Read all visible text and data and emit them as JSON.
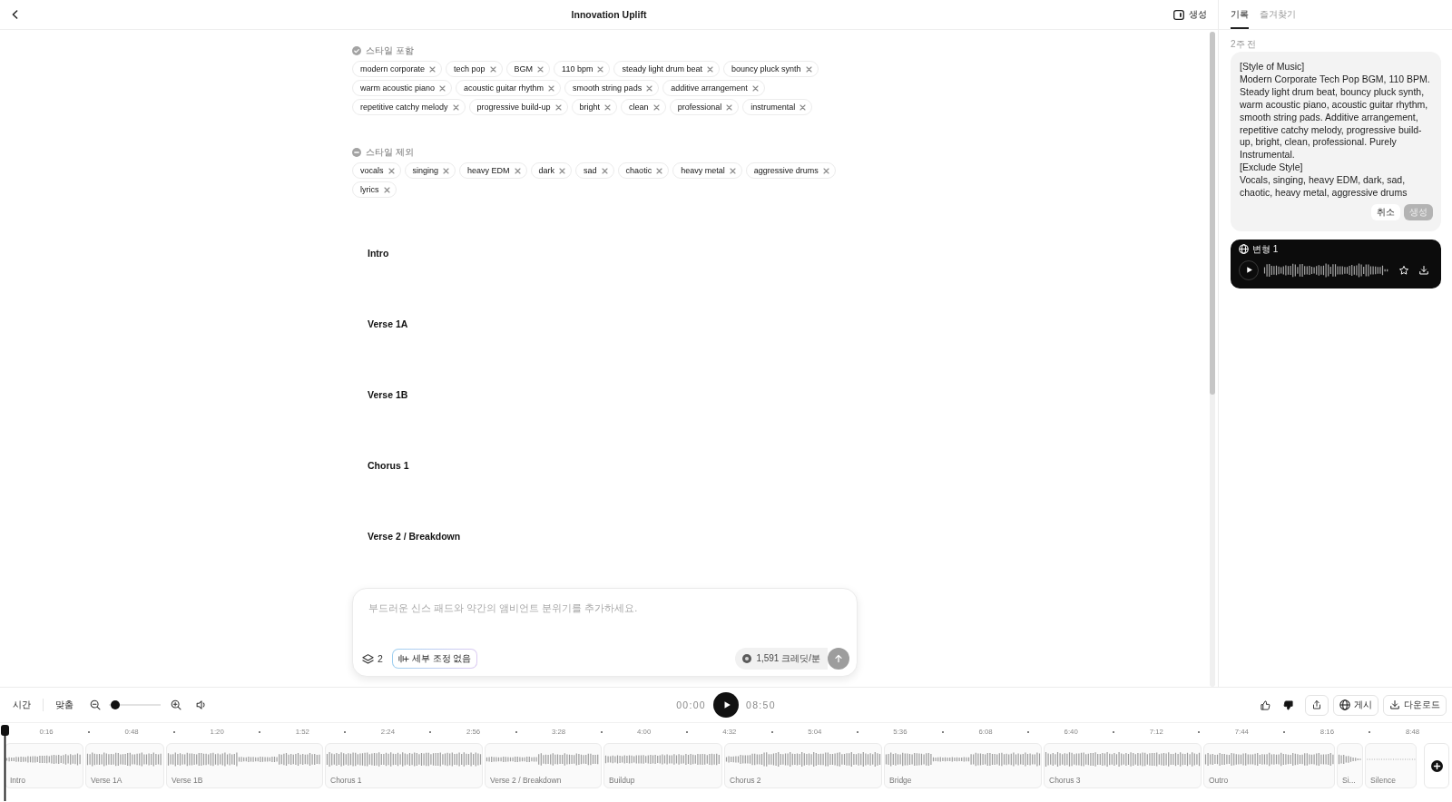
{
  "header": {
    "title": "Innovation Uplift",
    "panel_button": "생성"
  },
  "style_groups": [
    {
      "kind": "include",
      "heading": "스타일 포함",
      "tags": [
        "modern corporate",
        "tech pop",
        "BGM",
        "110 bpm",
        "steady light drum beat",
        "bouncy pluck synth",
        "warm acoustic piano",
        "acoustic guitar rhythm",
        "smooth string pads",
        "additive arrangement",
        "repetitive catchy melody",
        "progressive build-up",
        "bright",
        "clean",
        "professional",
        "instrumental"
      ]
    },
    {
      "kind": "exclude",
      "heading": "스타일 제외",
      "tags": [
        "vocals",
        "singing",
        "heavy EDM",
        "dark",
        "sad",
        "chaotic",
        "heavy metal",
        "aggressive drums",
        "lyrics"
      ]
    }
  ],
  "sections": [
    "Intro",
    "Verse 1A",
    "Verse 1B",
    "Chorus 1",
    "Verse 2 / Breakdown"
  ],
  "composer": {
    "placeholder": "부드러운 신스 패드와 약간의 앰비언트 분위기를 추가하세요.",
    "layer_count": "2",
    "fine_tune": "세부 조정 없음",
    "credits": "1,591 크레딧/분",
    "send_disabled": true
  },
  "side_panel": {
    "tabs": [
      {
        "label": "기록",
        "selected": true
      },
      {
        "label": "즐겨찾기",
        "selected": false
      }
    ],
    "timestamp": "2주 전",
    "prompt": {
      "text": "[Style of Music]\nModern Corporate Tech Pop BGM, 110 BPM. Steady light drum beat, bouncy pluck synth, warm acoustic piano, acoustic guitar rhythm, smooth string pads. Additive arrangement, repetitive catchy melody, progressive build-up, bright, clean, professional. Purely Instrumental.\n[Exclude Style]\nVocals, singing, heavy EDM, dark, sad, chaotic, heavy metal, aggressive drums",
      "buttons": [
        {
          "label": "취소",
          "disabled": false
        },
        {
          "label": "생성",
          "disabled": true
        }
      ]
    },
    "variant": {
      "label": "변형 1"
    }
  },
  "player": {
    "view_buttons": [
      "시간",
      "맞춤"
    ],
    "zoom": {
      "level": 0.05
    },
    "current_time": "00:00",
    "duration": "08:50",
    "liked": false,
    "disliked": true,
    "actions": [
      {
        "kind": "share"
      },
      {
        "kind": "publish",
        "label": "게시"
      },
      {
        "kind": "download",
        "label": "다운로드"
      }
    ]
  },
  "timeline": {
    "ticks": [
      "0:16",
      "0:48",
      "1:20",
      "1:52",
      "2:24",
      "2:56",
      "3:28",
      "4:00",
      "4:32",
      "5:04",
      "5:36",
      "6:08",
      "6:40",
      "7:12",
      "7:44",
      "8:16",
      "8:48"
    ],
    "clips": [
      "Intro",
      "Verse 1A",
      "Verse 1B",
      "Chorus 1",
      "Verse 2 / Breakdown",
      "Buildup",
      "Chorus 2",
      "Bridge",
      "Chorus 3",
      "Outro",
      "Si...",
      "Silence"
    ]
  }
}
